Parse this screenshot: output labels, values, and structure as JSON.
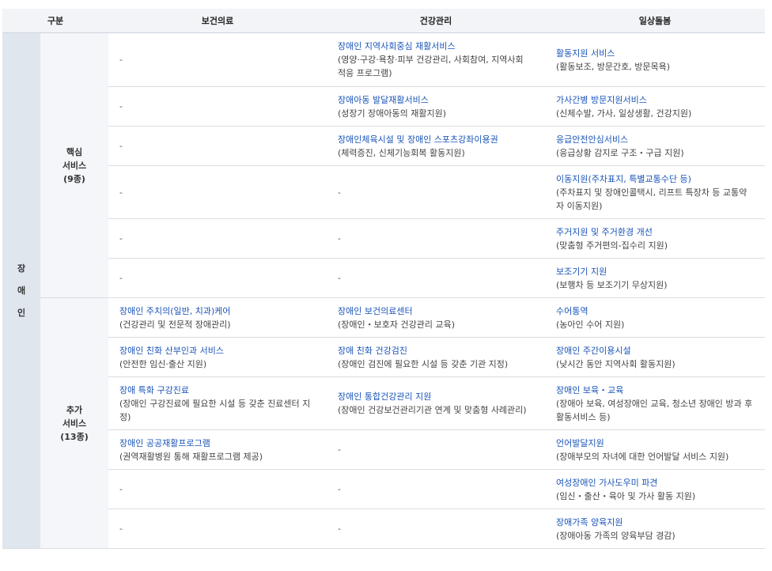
{
  "headers": [
    "구분",
    "보건의료",
    "건강관리",
    "일상돌봄"
  ],
  "category": [
    "장",
    "애",
    "인"
  ],
  "groups": {
    "core": [
      "핵심",
      "서비스",
      "(9종)"
    ],
    "extra": [
      "추가",
      "서비스",
      "(13종)"
    ]
  },
  "dash": "-",
  "rows": [
    {
      "health": null,
      "care": {
        "title": "장애인 지역사회중심 재활서비스",
        "desc": "(영양·구강·욕창·피부 건강관리, 사회참여, 지역사회 적응 프로그램)"
      },
      "daily": {
        "title": "활동지원 서비스",
        "desc": "(활동보조, 방문간호, 방문목욕)"
      }
    },
    {
      "health": null,
      "care": {
        "title": "장애아동 발달재활서비스",
        "desc": "(성장기 장애아동의 재활지원)"
      },
      "daily": {
        "title": "가사간병 방문지원서비스",
        "desc": "(신체수발, 가사, 일상생활, 건강지원)"
      }
    },
    {
      "health": null,
      "care": {
        "title": "장애인체육시설 및 장애인 스포츠강좌이용권",
        "desc": "(체력증진, 신체기능회복 활동지원)"
      },
      "daily": {
        "title": "응급안전안심서비스",
        "desc": "(응급상황 감지로 구조・구급 지원)"
      }
    },
    {
      "health": null,
      "care": null,
      "daily": {
        "title": "이동지원(주차표지, 특별교통수단 등)",
        "desc": "(주차표지 및 장애인콜택시, 리프트 특장차 등 교통약자 이동지원)"
      }
    },
    {
      "health": null,
      "care": null,
      "daily": {
        "title": "주거지원 및 주거환경 개선",
        "desc": "(맞춤형 주거편의-집수리 지원)"
      }
    },
    {
      "health": null,
      "care": null,
      "daily": {
        "title": "보조기기 지원",
        "desc": "(보행차 등 보조기기 무상지원)"
      }
    },
    {
      "health": {
        "title": "장애인 주치의(일반, 치과)케어",
        "desc": "(건강관리 및 전문적 장애관리)"
      },
      "care": {
        "title": "장애인 보건의료센터",
        "desc": "(장애인・보호자 건강관리 교육)"
      },
      "daily": {
        "title": "수어통역",
        "desc": "(농아인 수어 지원)"
      }
    },
    {
      "health": {
        "title": "장애인 친화 산부인과 서비스",
        "desc": "(안전한 임신·출산 지원)"
      },
      "care": {
        "title": "장애 친화 건강검진",
        "desc": "(장애인 검진에 필요한 시설 등 갖춘 기관 지정)"
      },
      "daily": {
        "title": "장애인 주간이용시설",
        "desc": "(낮시간 동안 지역사회 활동지원)"
      }
    },
    {
      "health": {
        "title": "장애 특화 구강진료",
        "desc": "(장애인 구강진료에 필요한 시설 등 갖춘 진료센터 지정)"
      },
      "care": {
        "title": "장애인 통합건강관리 지원",
        "desc": "(장애인 건강보건관리기관 연계 및 맞춤형 사례관리)"
      },
      "daily": {
        "title": "장애인 보육・교육",
        "desc": "(장애아 보육, 여성장애인 교육, 청소년 장애인 방과 후 활동서비스 등)"
      }
    },
    {
      "health": {
        "title": "장애인 공공재활프로그램",
        "desc": "(권역재활병원 통해 재활프로그램 제공)"
      },
      "care": null,
      "daily": {
        "title": "언어발달지원",
        "desc": "(장애부모의 자녀에 대한 언어발달 서비스 지원)"
      }
    },
    {
      "health": null,
      "care": null,
      "daily": {
        "title": "여성장애인 가사도우미 파견",
        "desc": "(임신・출산・육아 및 가사 활동 지원)"
      }
    },
    {
      "health": null,
      "care": null,
      "daily": {
        "title": "장애가족 양육지원",
        "desc": "(장애아동 가족의 양육부담 경감)"
      }
    }
  ]
}
